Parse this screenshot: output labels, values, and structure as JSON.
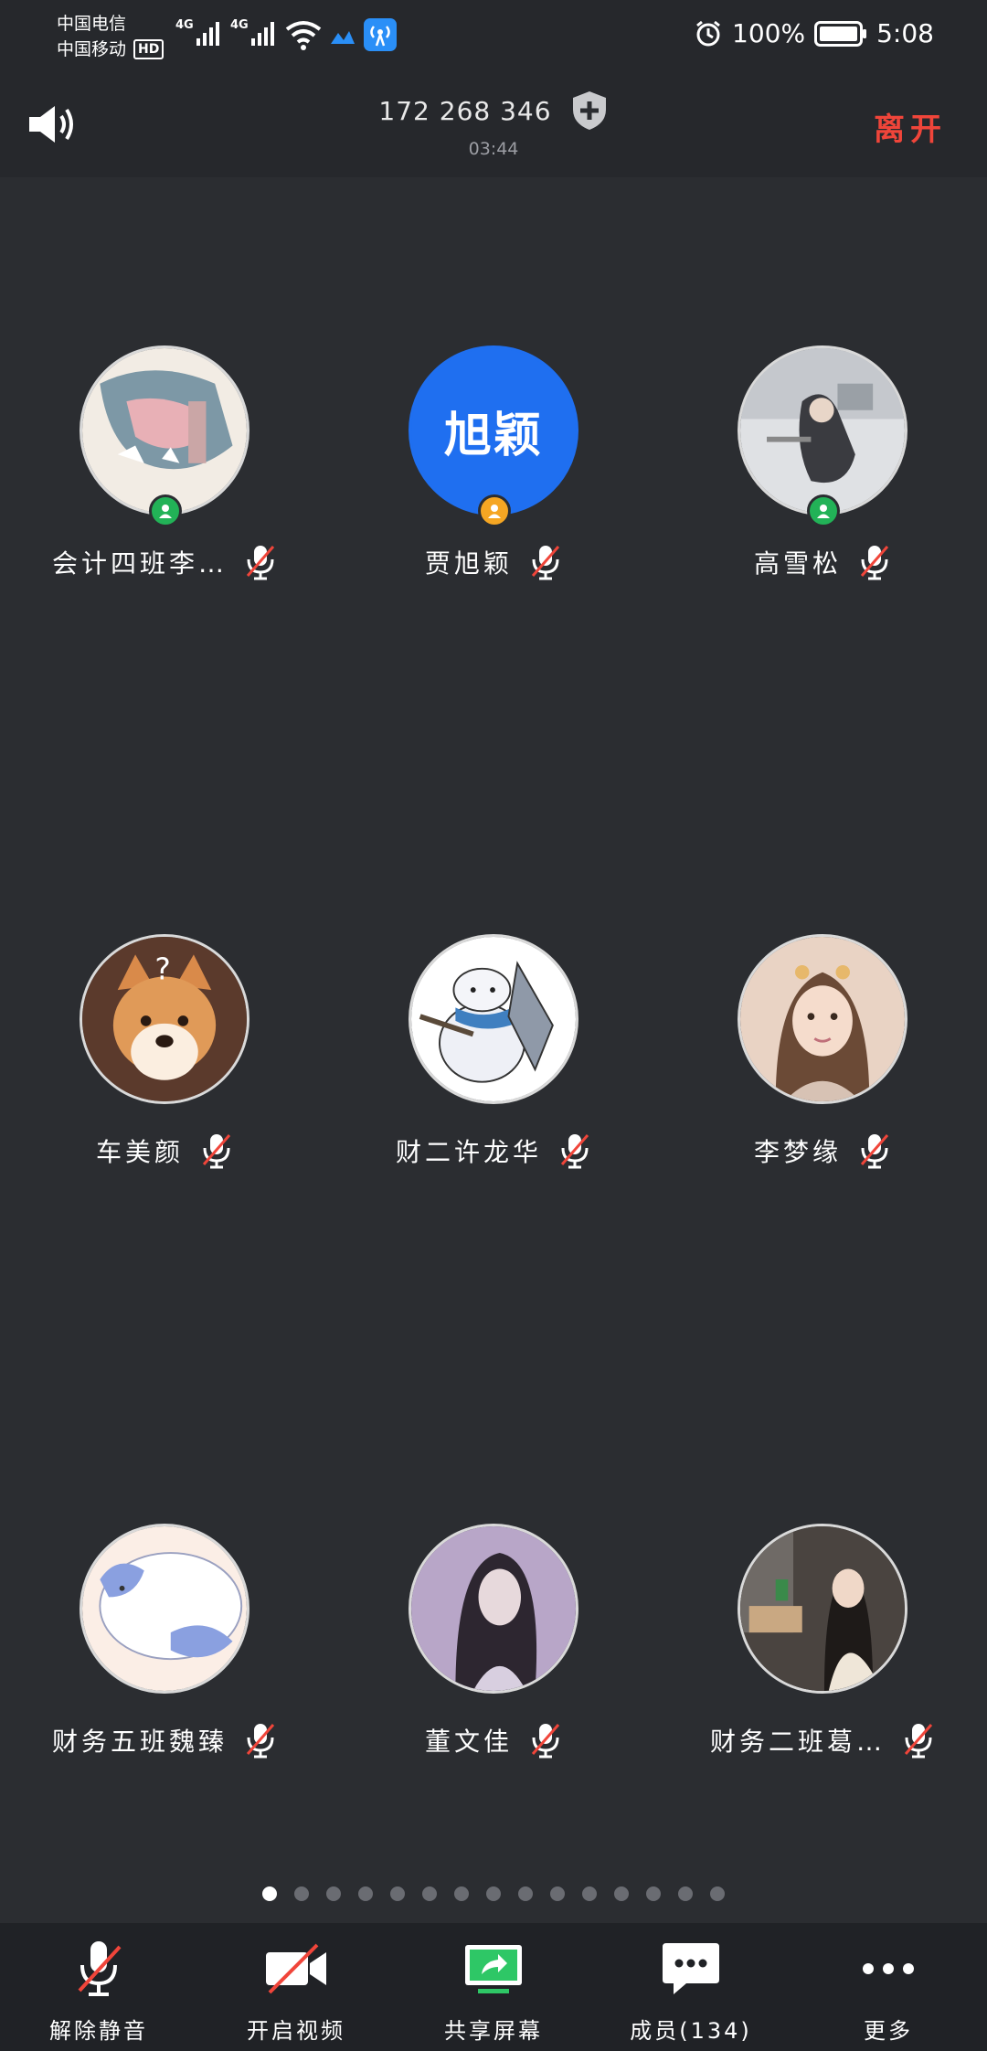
{
  "status_bar": {
    "carrier_1": "中国电信",
    "carrier_2": "中国移动",
    "hd": "HD",
    "net_1": "4G",
    "net_2": "4G",
    "battery": "100%",
    "time": "5:08"
  },
  "header": {
    "meeting_id": "172 268 346",
    "timer": "03:44",
    "leave_label": "离开"
  },
  "participants": [
    {
      "name": "会计四班李…",
      "avatar": "drawing-dinosaur",
      "badge": "green",
      "mic": "muted"
    },
    {
      "name": "贾旭颖",
      "avatar_text": "旭颖",
      "avatar": "text-blue",
      "badge": "orange",
      "mic": "muted"
    },
    {
      "name": "高雪松",
      "avatar": "photo-grey",
      "badge": "green",
      "mic": "muted"
    },
    {
      "name": "车美颜",
      "avatar": "shiba-dog",
      "mic": "muted"
    },
    {
      "name": "财二许龙华",
      "avatar": "cartoon-robot-knight",
      "mic": "muted"
    },
    {
      "name": "李梦缘",
      "avatar": "photo-girl",
      "mic": "muted"
    },
    {
      "name": "财务五班魏臻",
      "avatar": "cartoon-cat",
      "mic": "muted"
    },
    {
      "name": "董文佳",
      "avatar": "photo-purple",
      "mic": "muted"
    },
    {
      "name": "财务二班葛…",
      "avatar": "photo-room",
      "mic": "muted"
    }
  ],
  "pager": {
    "total": 15,
    "active": 0
  },
  "toolbar": {
    "unmute_label": "解除静音",
    "video_label": "开启视频",
    "share_label": "共享屏幕",
    "members_label": "成员(134)",
    "more_label": "更多"
  },
  "colors": {
    "background": "#2b2d31",
    "leave": "#f0453a",
    "badge_green": "#22b257",
    "badge_orange": "#f5a623",
    "avatar_blue": "#1f6ff0",
    "share_green": "#2ec766"
  }
}
